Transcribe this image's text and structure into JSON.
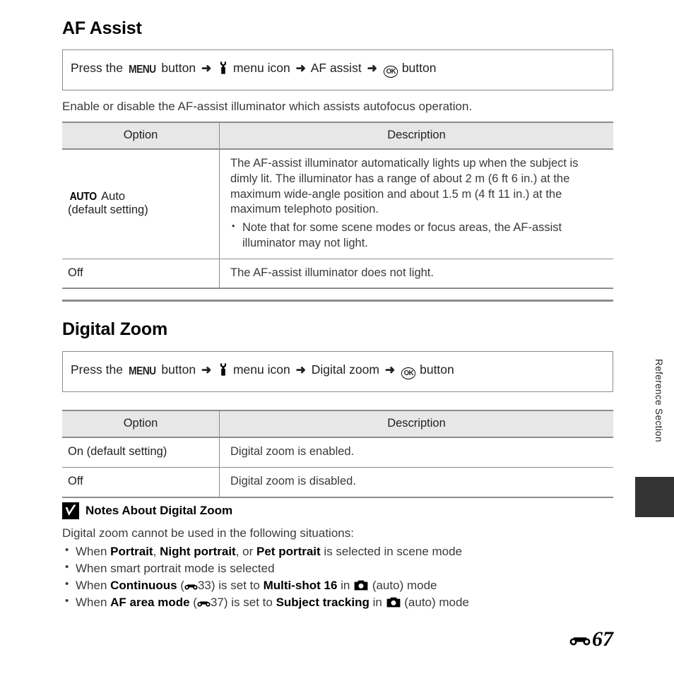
{
  "page": {
    "number": "67",
    "number_prefix_icon": "reference-section-icon",
    "side_tab_label": "Reference Section"
  },
  "sections": [
    {
      "id": "af-assist",
      "title": "AF Assist",
      "command_path": {
        "prefix": "Press the",
        "menu_label": "MENU",
        "after_menu": "button",
        "arrow": "➜",
        "menu_icon": "setup-menu-wrench-icon",
        "menu_icon_label": "menu icon",
        "item": "AF assist",
        "ok_label": "OK",
        "ok_icon": "ok-button-icon",
        "suffix": "button"
      },
      "intro": "Enable or disable the AF-assist illuminator which assists autofocus operation.",
      "table": {
        "headers": [
          "Option",
          "Description"
        ],
        "rows": [
          {
            "option_glyph": "AUTO",
            "option_label": "Auto",
            "option_sub": "(default setting)",
            "description": "The AF-assist illuminator automatically lights up when the subject is dimly lit. The illuminator has a range of about 2 m (6 ft 6 in.) at the maximum wide-angle position and about 1.5 m (4 ft 11 in.) at the maximum telephoto position.",
            "bullets": [
              "Note that for some scene modes or focus areas, the AF-assist illuminator may not light."
            ]
          },
          {
            "option_glyph": "",
            "option_label": "Off",
            "option_sub": "",
            "description": "The AF-assist illuminator does not light.",
            "bullets": []
          }
        ]
      }
    },
    {
      "id": "digital-zoom",
      "title": "Digital Zoom",
      "command_path": {
        "prefix": "Press the",
        "menu_label": "MENU",
        "after_menu": "button",
        "arrow": "➜",
        "menu_icon": "setup-menu-wrench-icon",
        "menu_icon_label": "menu icon",
        "item": "Digital zoom",
        "ok_label": "OK",
        "ok_icon": "ok-button-icon",
        "suffix": "button"
      },
      "table": {
        "headers": [
          "Option",
          "Description"
        ],
        "rows": [
          {
            "option_label": "On (default setting)",
            "description": "Digital zoom is enabled."
          },
          {
            "option_label": "Off",
            "description": "Digital zoom is disabled."
          }
        ]
      }
    }
  ],
  "notes": {
    "icon": "caution-check-icon",
    "title": "Notes About Digital Zoom",
    "intro": "Digital zoom cannot be used in the following situations:",
    "items": [
      {
        "parts": [
          {
            "t": "When ",
            "b": false
          },
          {
            "t": "Portrait",
            "b": true
          },
          {
            "t": ", ",
            "b": false
          },
          {
            "t": "Night portrait",
            "b": true
          },
          {
            "t": ", or ",
            "b": false
          },
          {
            "t": "Pet portrait",
            "b": true
          },
          {
            "t": " is selected in scene mode",
            "b": false
          }
        ]
      },
      {
        "parts": [
          {
            "t": "When smart portrait mode is selected",
            "b": false
          }
        ]
      },
      {
        "parts": [
          {
            "t": "When ",
            "b": false
          },
          {
            "t": "Continuous",
            "b": true
          },
          {
            "t": " (",
            "b": false
          },
          {
            "t": "ref",
            "b": false,
            "icon": "reference-section-icon"
          },
          {
            "t": "33) is set to ",
            "b": false
          },
          {
            "t": "Multi-shot 16",
            "b": true
          },
          {
            "t": " in ",
            "b": false
          },
          {
            "t": "cam",
            "b": false,
            "icon": "camera-auto-mode-icon"
          },
          {
            "t": " (auto) mode",
            "b": false
          }
        ]
      },
      {
        "parts": [
          {
            "t": "When ",
            "b": false
          },
          {
            "t": "AF area mode",
            "b": true
          },
          {
            "t": " (",
            "b": false
          },
          {
            "t": "ref",
            "b": false,
            "icon": "reference-section-icon"
          },
          {
            "t": "37) is set to ",
            "b": false
          },
          {
            "t": "Subject tracking",
            "b": true
          },
          {
            "t": " in ",
            "b": false
          },
          {
            "t": "cam",
            "b": false,
            "icon": "camera-auto-mode-icon"
          },
          {
            "t": " (auto) mode",
            "b": false
          }
        ]
      }
    ]
  },
  "colors": {
    "rule": "#8c8c8c",
    "header_fill": "#e7e7e7",
    "body_text": "#3a3a3a",
    "tab_block": "#333333"
  }
}
